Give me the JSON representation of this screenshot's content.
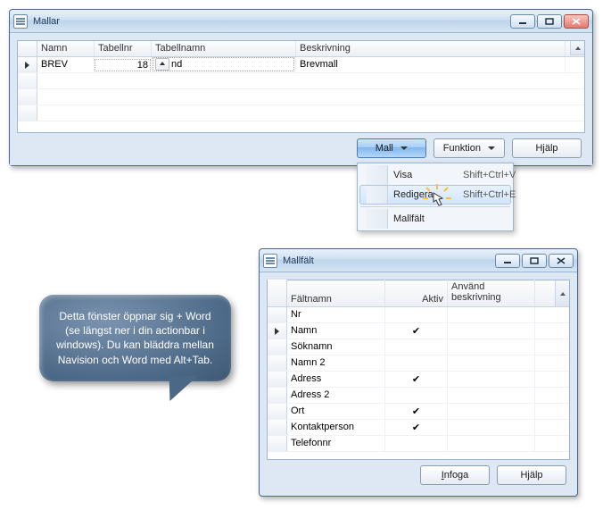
{
  "window1": {
    "title": "Mallar",
    "columns": {
      "c1": "Namn",
      "c2": "Tabellnr",
      "c3": "Tabellnamn",
      "c4": "Beskrivning"
    },
    "row": {
      "namn": "BREV",
      "tabellnr": "18",
      "tabellnamn_suffix": "nd",
      "beskrivning": "Brevmall"
    },
    "buttons": {
      "mall": "Mall",
      "funktion": "Funktion",
      "hjalp": "Hjälp"
    }
  },
  "dropdown": {
    "visa": {
      "label": "Visa",
      "shortcut": "Shift+Ctrl+V"
    },
    "redigera": {
      "label": "Redigera",
      "shortcut": "Shift+Ctrl+E"
    },
    "mallfalt": {
      "label": "Mallfält"
    }
  },
  "window2": {
    "title": "Mallfält",
    "columns": {
      "c1": "Fältnamn",
      "c2": "Aktiv",
      "c3": "Använd beskrivning"
    },
    "rows": [
      {
        "name": "Nr",
        "aktiv": ""
      },
      {
        "name": "Namn",
        "aktiv": "✔",
        "active": true
      },
      {
        "name": "Söknamn",
        "aktiv": ""
      },
      {
        "name": "Namn 2",
        "aktiv": ""
      },
      {
        "name": "Adress",
        "aktiv": "✔"
      },
      {
        "name": "Adress 2",
        "aktiv": ""
      },
      {
        "name": "Ort",
        "aktiv": "✔"
      },
      {
        "name": "Kontaktperson",
        "aktiv": "✔"
      },
      {
        "name": "Telefonnr",
        "aktiv": ""
      }
    ],
    "buttons": {
      "infoga": "Infoga",
      "hjalp": "Hjälp"
    }
  },
  "callout": {
    "text": "Detta fönster öppnar sig + Word (se längst ner i din actionbar i windows). Du kan bläddra mellan Navision och Word med Alt+Tab."
  }
}
